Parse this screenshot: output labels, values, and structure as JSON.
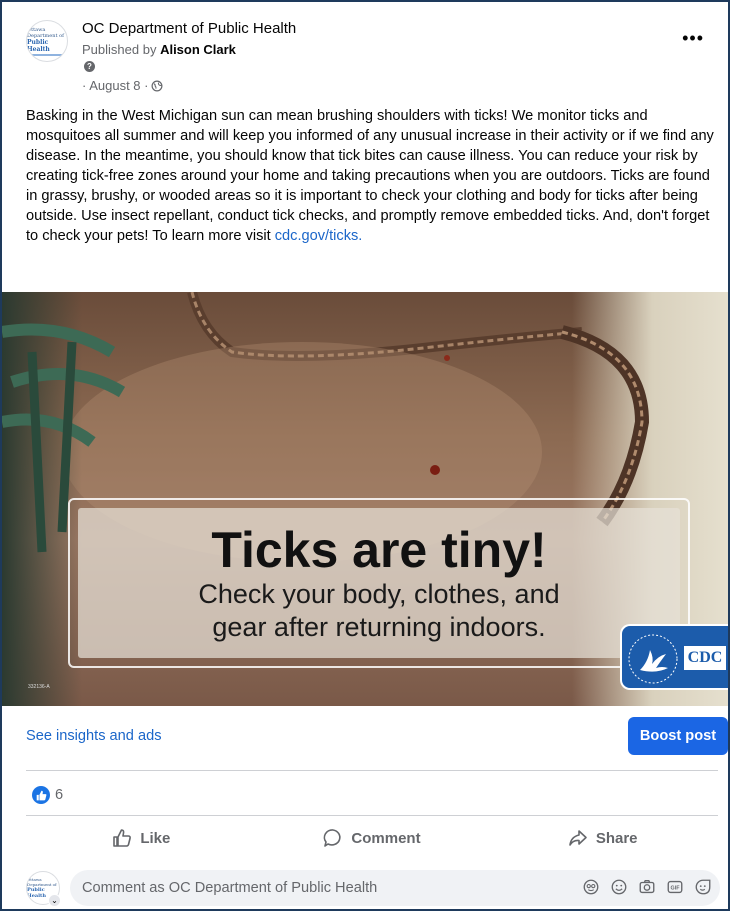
{
  "post": {
    "page_name": "OC Department of Public Health",
    "published_prefix": "Published by ",
    "published_by": "Alison Clark",
    "date": "· August 8 ·",
    "avatar_line1": "Ottawa Department of",
    "avatar_line2": "Public Health",
    "text": "Basking in the West Michigan sun can mean brushing shoulders with ticks! We monitor ticks and mosquitoes all summer and will keep you informed of any unusual increase in their activity or if we find any disease. In the meantime, you should know that tick bites can cause illness. You can reduce your risk by creating tick-free zones around your home and taking precautions when you are outdoors. Ticks are found in grassy, brushy, or wooded areas so it is important to check your clothing and body for ticks after being outside. Use insect repellant, conduct tick checks, and promptly remove embedded ticks. And, don't forget to check your pets! To learn more visit ",
    "link": "cdc.gov/ticks.",
    "image": {
      "title": "Ticks are tiny!",
      "subtitle_line1": "Check your body, clothes, and",
      "subtitle_line2": "gear after returning indoors.",
      "logo_text": "CDC",
      "image_id": "332136-A"
    }
  },
  "insights": {
    "link_label": "See insights and ads",
    "boost_label": "Boost post"
  },
  "reactions": {
    "like_count": "6"
  },
  "actions": {
    "like": "Like",
    "comment": "Comment",
    "share": "Share"
  },
  "comment": {
    "placeholder": "Comment as OC Department of Public Health"
  },
  "colors": {
    "accent": "#1b66e4",
    "link": "#1b66c9",
    "frame": "#1e3a5c"
  }
}
